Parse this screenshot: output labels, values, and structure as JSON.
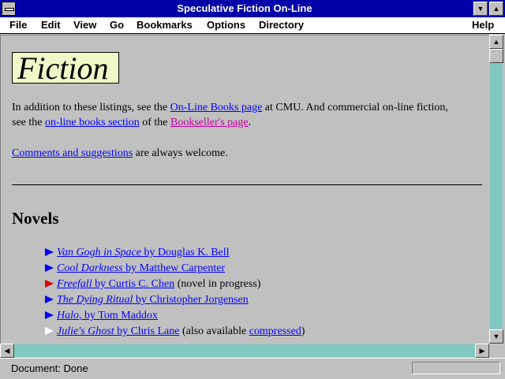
{
  "window": {
    "title": "Speculative Fiction On-Line"
  },
  "menubar": {
    "items": [
      {
        "label": "File"
      },
      {
        "label": "Edit"
      },
      {
        "label": "View"
      },
      {
        "label": "Go"
      },
      {
        "label": "Bookmarks"
      },
      {
        "label": "Options"
      },
      {
        "label": "Directory"
      },
      {
        "label": "Help"
      }
    ]
  },
  "page": {
    "heading_image_text": "Fiction",
    "intro": {
      "text1": "In addition to these listings, see the ",
      "link1": "On-Line Books page",
      "text2": " at CMU. And commercial on-line fiction,",
      "text3": "see the ",
      "link2": "on-line books section",
      "text4": " of the ",
      "link3": "Bookseller's page",
      "text5": "."
    },
    "comments": {
      "link": "Comments and suggestions",
      "text": " are always welcome."
    },
    "section_title": "Novels",
    "novels": [
      {
        "title": "Van Gogh in Space",
        "by": " by Douglas K. Bell",
        "note": "",
        "bullet": "blue"
      },
      {
        "title": "Cool Darkness",
        "by": " by Matthew Carpenter",
        "note": "",
        "bullet": "blue"
      },
      {
        "title": "Freefall",
        "by": " by Curtis C. Chen",
        "note": " (novel in progress)",
        "bullet": "red"
      },
      {
        "title": "The Dying Ritual",
        "by": " by Christopher Jorgensen",
        "note": "",
        "bullet": "blue"
      },
      {
        "title": "Halo",
        "by": ", by Tom Maddox",
        "note": "",
        "bullet": "blue"
      },
      {
        "title": "Julie's Ghost",
        "by": " by Chris Lane",
        "note_pre": " (also available ",
        "note_link": "compressed",
        "note_post": ")",
        "bullet": "hollow"
      }
    ]
  },
  "statusbar": {
    "text": "Document: Done"
  },
  "colors": {
    "titlebar": "#0000a8",
    "link": "#0000ff",
    "visited_link": "#c000a0",
    "scroll_track": "#80c8c0",
    "heading_box": "#f0f8c8"
  }
}
